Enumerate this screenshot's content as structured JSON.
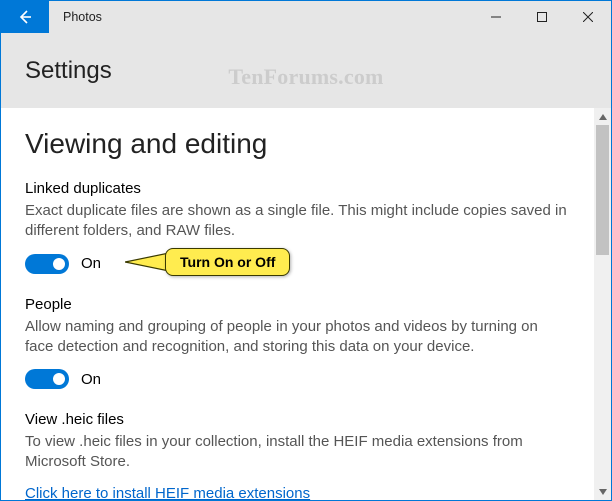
{
  "titlebar": {
    "title": "Photos"
  },
  "header": {
    "title": "Settings"
  },
  "watermark": "TenForums.com",
  "content": {
    "section_heading": "Viewing and editing",
    "linked_duplicates": {
      "title": "Linked duplicates",
      "desc": "Exact duplicate files are shown as a single file. This might include copies saved in different folders, and RAW files.",
      "toggle_label": "On"
    },
    "callout": {
      "text": "Turn On or Off"
    },
    "people": {
      "title": "People",
      "desc": "Allow naming and grouping of people in your photos and videos by turning on face detection and recognition, and storing this data on your device.",
      "toggle_label": "On"
    },
    "heic": {
      "title": "View .heic files",
      "desc": "To view .heic files in your collection, install the HEIF media extensions from Microsoft Store.",
      "link_text": "Click here to install HEIF media extensions"
    }
  }
}
